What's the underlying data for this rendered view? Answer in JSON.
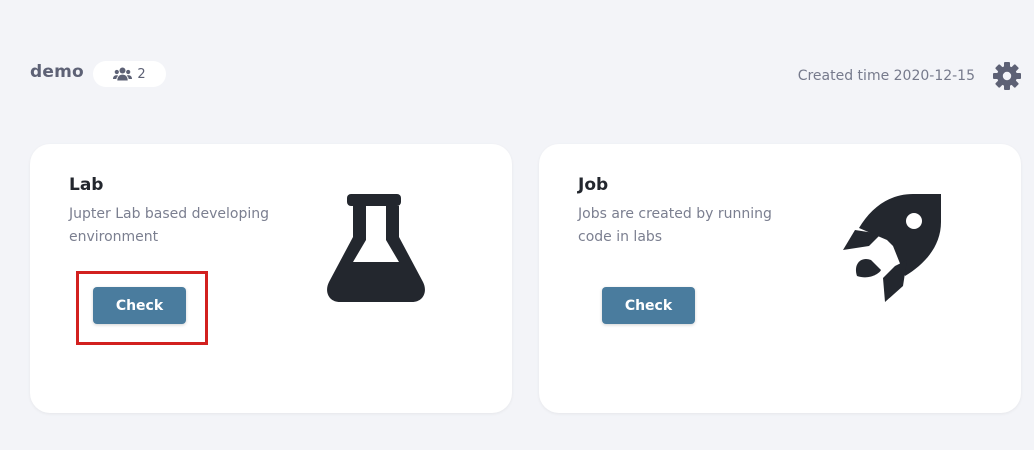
{
  "header": {
    "project_name": "demo",
    "member_count": "2",
    "created_time": "Created time 2020-12-15"
  },
  "cards": [
    {
      "title": "Lab",
      "description": "Jupter Lab based developing environment",
      "button_label": "Check",
      "icon": "flask-icon"
    },
    {
      "title": "Job",
      "description": "Jobs are created by running code in labs",
      "button_label": "Check",
      "icon": "rocket-icon"
    }
  ],
  "colors": {
    "background": "#f3f4f8",
    "button": "#4a7c9e",
    "icon": "#23272e",
    "highlight": "#d2201f"
  }
}
